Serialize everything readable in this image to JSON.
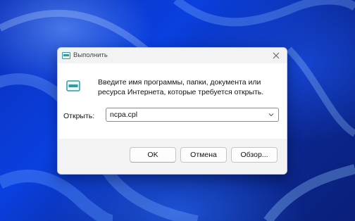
{
  "dialog": {
    "title": "Выполнить",
    "prompt_line1": "Введите имя программы, папки, документа или",
    "prompt_line2": "ресурса Интернета, которые требуется открыть.",
    "open_label": "Открыть:",
    "open_value": "ncpa.cpl",
    "buttons": {
      "ok": "OK",
      "cancel": "Отмена",
      "browse": "Обзор..."
    },
    "icons": {
      "title": "run-icon",
      "main": "run-icon",
      "close": "close-icon",
      "dropdown": "chevron-down-icon"
    }
  },
  "colors": {
    "desktop_base": "#0b2fb8",
    "dialog_bg": "#f3f3f3",
    "content_bg": "#ffffff",
    "icon_accent": "#2f9aa3"
  }
}
